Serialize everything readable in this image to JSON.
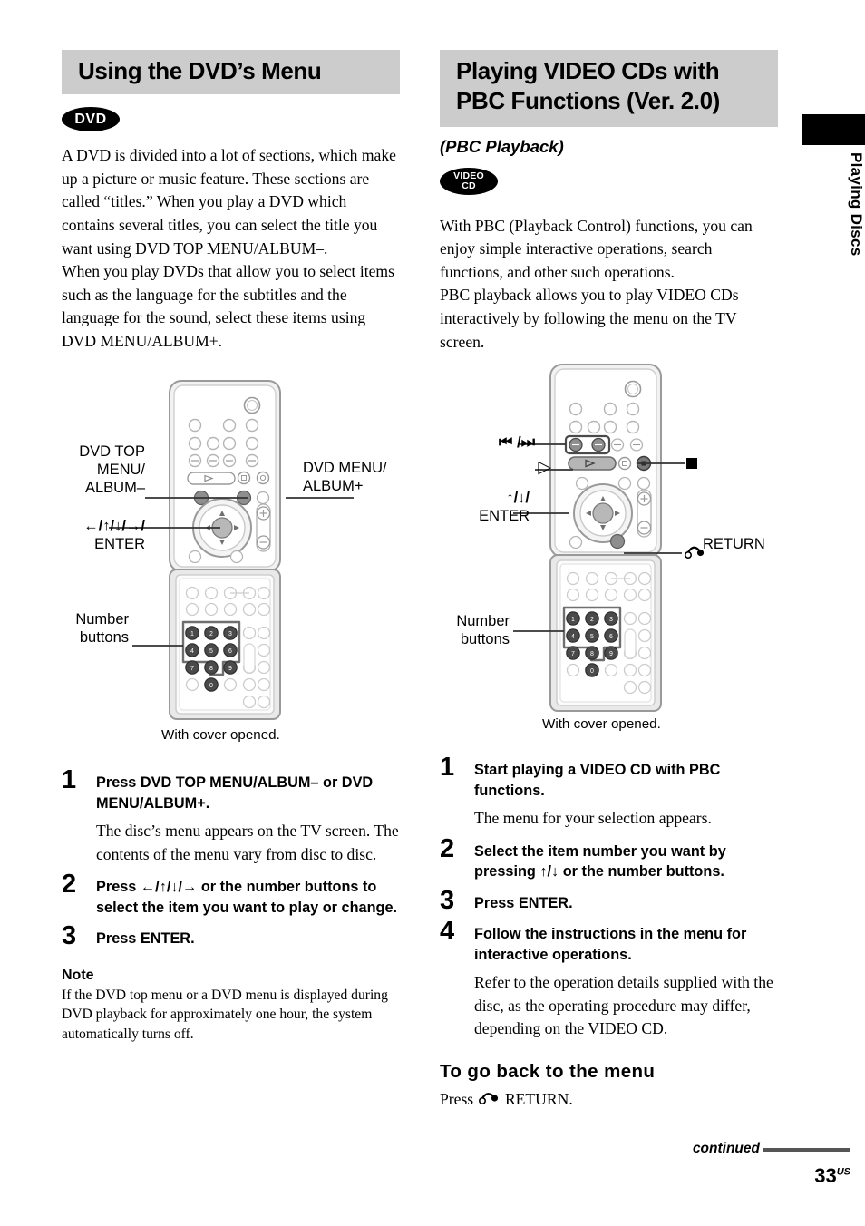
{
  "page": {
    "number": "33",
    "number_suffix": "US",
    "continued_label": "continued",
    "side_tab_label": "Playing Discs",
    "accent_gray": "#cccccc",
    "rule_gray": "#555555"
  },
  "left_column": {
    "section_title": "Using the DVD’s Menu",
    "badge": {
      "name": "dvd-badge",
      "line1": "DVD"
    },
    "intro": [
      "A DVD is divided into a lot of sections, which make up a picture or music feature. These sections are called “titles.” When you play a DVD which contains several titles, you can select the title you want using DVD TOP MENU/ALBUM–.",
      "When you play DVDs that allow you to select items such as the language for the subtitles and the language for the sound, select these items using DVD MENU/ALBUM+."
    ],
    "diagram": {
      "caption": "With cover opened.",
      "labels": {
        "dvd_top_menu": "DVD TOP\nMENU/\nALBUM–",
        "dvd_top_menu_l1": "DVD TOP",
        "dvd_top_menu_l2": "MENU/",
        "dvd_top_menu_l3": "ALBUM–",
        "dvd_menu_l1": "DVD MENU/",
        "dvd_menu_l2": "ALBUM+",
        "arrows_l1": "←/↑/↓/→/",
        "arrows_l2": "ENTER",
        "number_l1": "Number",
        "number_l2": "buttons"
      }
    },
    "steps": [
      {
        "num": "1",
        "title": "Press DVD TOP MENU/ALBUM– or DVD MENU/ALBUM+.",
        "desc": "The disc’s menu appears on the TV screen. The contents of the menu vary from disc to disc."
      },
      {
        "num": "2",
        "title": "Press ←/↑/↓/→ or the number buttons to select the item you want to play or change.",
        "desc": ""
      },
      {
        "num": "3",
        "title": "Press ENTER.",
        "desc": ""
      }
    ],
    "note": {
      "heading": "Note",
      "body": "If the DVD top menu or a DVD menu is displayed during DVD playback for approximately one hour, the system automatically turns off."
    }
  },
  "right_column": {
    "section_title_line1": "Playing VIDEO CDs with",
    "section_title_line2": "PBC Functions (Ver. 2.0)",
    "subtitle": "(PBC Playback)",
    "badge": {
      "name": "video-cd-badge",
      "line1": "VIDEO",
      "line2": "CD"
    },
    "intro": [
      "With PBC (Playback Control) functions, you can enjoy simple interactive operations, search functions, and other such operations.",
      "PBC playback allows you to play VIDEO CDs interactively by following the menu on the TV screen."
    ],
    "diagram": {
      "caption": "With cover opened.",
      "labels": {
        "skip": "⏮ /⏭",
        "play": "▷",
        "enter_l1": "↑/↓/",
        "enter_l2": "ENTER",
        "stop": "",
        "return": "RETURN",
        "number_l1": "Number",
        "number_l2": "buttons"
      }
    },
    "steps": [
      {
        "num": "1",
        "title": "Start playing a VIDEO CD with PBC functions.",
        "desc": "The menu for your selection appears."
      },
      {
        "num": "2",
        "title": "Select the item number you want by pressing ↑/↓ or the number buttons.",
        "desc": ""
      },
      {
        "num": "3",
        "title": "Press ENTER.",
        "desc": ""
      },
      {
        "num": "4",
        "title": "Follow the instructions in the menu for interactive operations.",
        "desc": "Refer to the operation details supplied with the disc, as the operating procedure may differ, depending on the VIDEO CD."
      }
    ],
    "go_back": {
      "heading": "To go back to the menu",
      "body_prefix": "Press ",
      "body_suffix": " RETURN."
    }
  }
}
